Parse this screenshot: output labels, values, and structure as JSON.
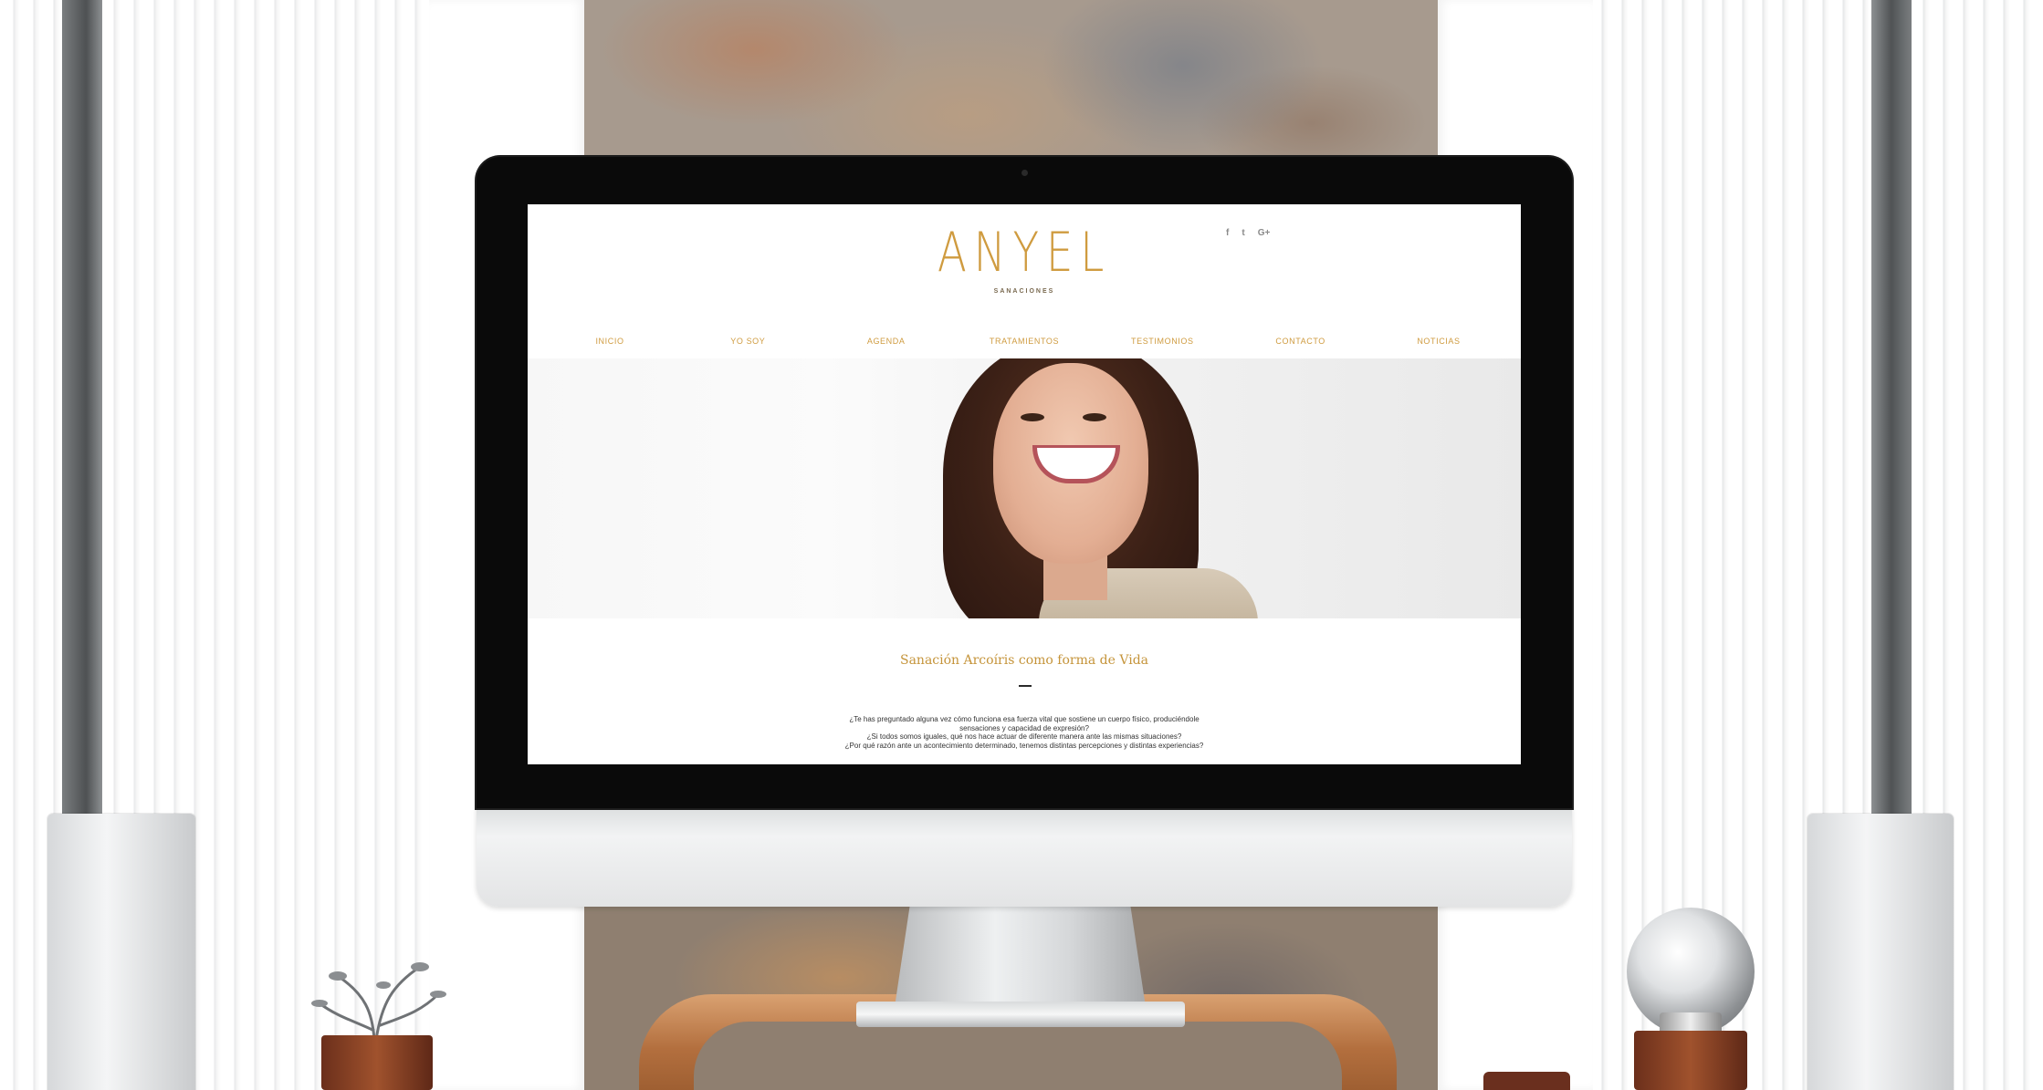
{
  "site": {
    "logo": "ANYEL",
    "tagline": "SANACIONES",
    "social": [
      {
        "icon": "facebook-icon",
        "glyph": "f"
      },
      {
        "icon": "twitter-icon",
        "glyph": "t"
      },
      {
        "icon": "google-plus-icon",
        "glyph": "G+"
      }
    ],
    "nav": [
      "INICIO",
      "YO SOY",
      "AGENDA",
      "TRATAMIENTOS",
      "TESTIMONIOS",
      "CONTACTO",
      "NOTICIAS"
    ],
    "section_title": "Sanación Arcoíris como forma de Vida",
    "intro_lines": [
      "¿Te has preguntado alguna vez cómo funciona esa fuerza vital que sostiene un cuerpo físico, produciéndole",
      "sensaciones y capacidad de expresión?",
      "¿Si todos somos iguales, qué nos hace actuar de diferente manera ante las mismas situaciones?",
      "¿Por qué razón ante un acontecimiento determinado, tenemos distintas percepciones y distintas experiencias?"
    ]
  },
  "colors": {
    "brand_gold": "#cf9b3f",
    "title_gold": "#c5943a",
    "bezel": "#0a0a0a"
  }
}
